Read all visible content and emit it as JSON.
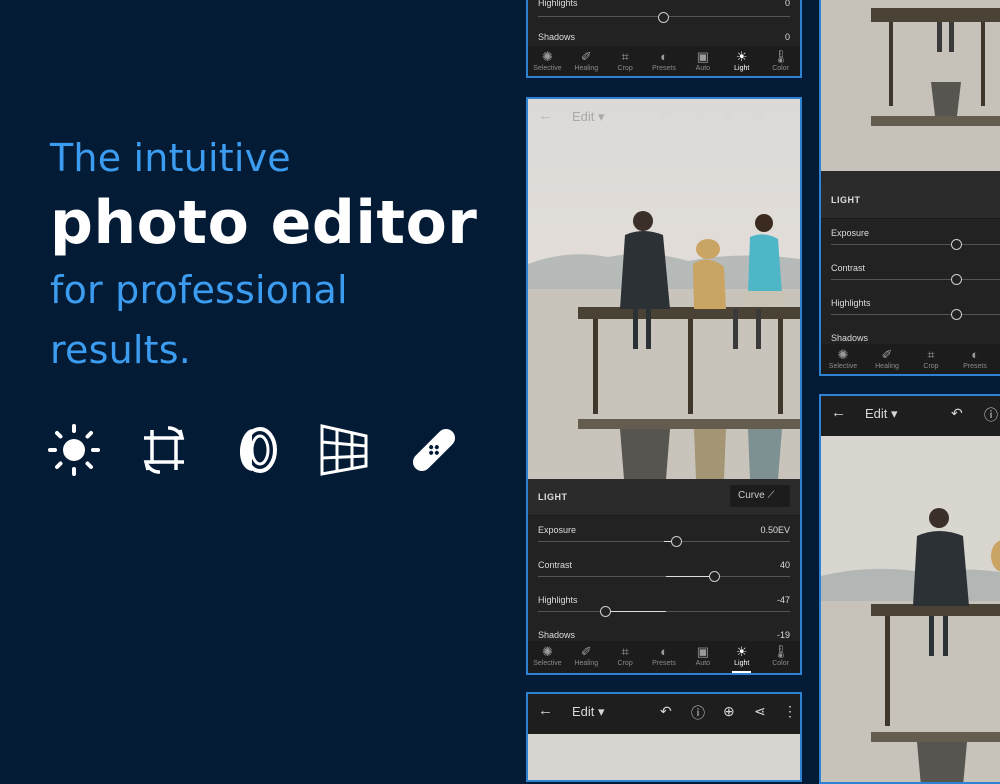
{
  "promo": {
    "line1": "The intuitive",
    "line2": "photo editor",
    "line3": "for professional",
    "line4": "results."
  },
  "feature_icons": [
    "sun-icon",
    "crop-rotate-icon",
    "lens-icon",
    "perspective-grid-icon",
    "bandage-icon"
  ],
  "colors": {
    "background": "#041b36",
    "accent": "#3b9cf0",
    "frame": "#2d82d4"
  },
  "editor": {
    "back_icon": "←",
    "edit_label": "Edit",
    "panel_title": "LIGHT",
    "curve_label": "Curve",
    "sliders": [
      {
        "label": "Exposure",
        "value": "0.50EV"
      },
      {
        "label": "Contrast",
        "value": "40"
      },
      {
        "label": "Highlights",
        "value": "-47"
      },
      {
        "label": "Shadows",
        "value": "-19"
      }
    ],
    "top_sliders": [
      {
        "label": "Highlights",
        "value": "0"
      },
      {
        "label": "Shadows",
        "value": "0"
      }
    ],
    "right_sliders": [
      {
        "label": "Exposure"
      },
      {
        "label": "Contrast"
      },
      {
        "label": "Highlights"
      },
      {
        "label": "Shadows"
      }
    ],
    "tools": [
      "Selective",
      "Healing",
      "Crop",
      "Presets",
      "Auto",
      "Light",
      "Color"
    ],
    "active_tool": "Light"
  }
}
